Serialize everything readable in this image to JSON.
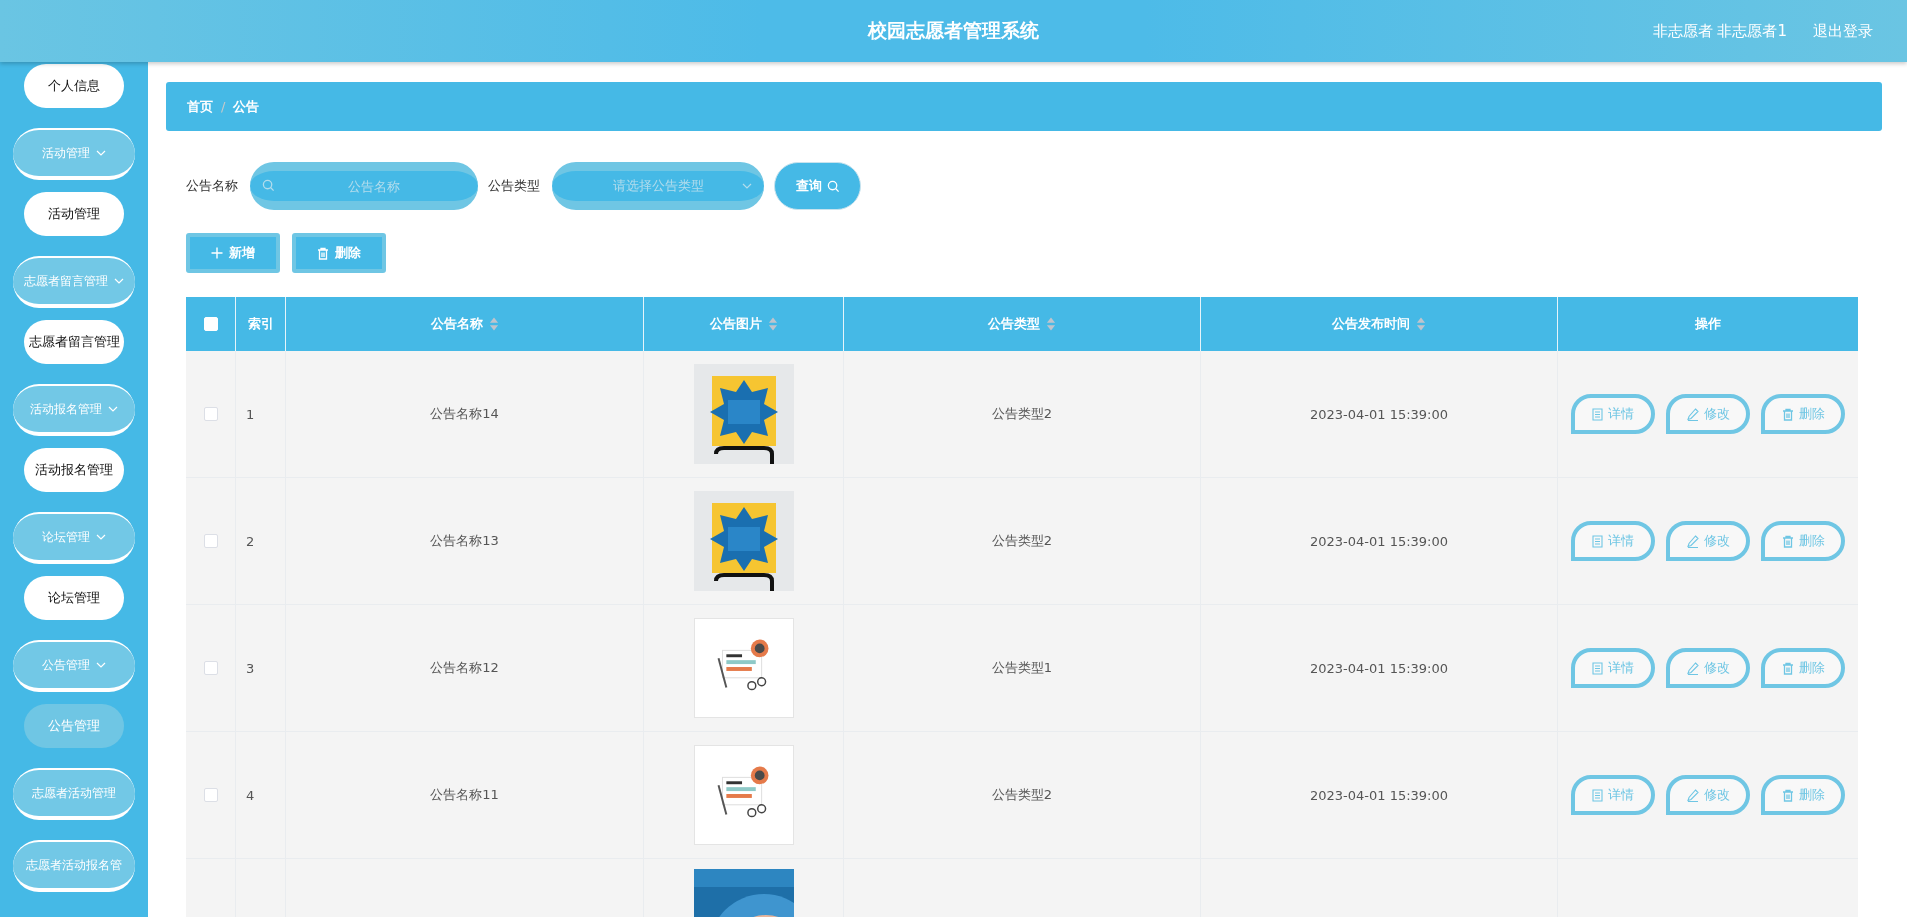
{
  "header": {
    "title": "校园志愿者管理系统",
    "user": "非志愿者 非志愿者1",
    "logout": "退出登录"
  },
  "sidebar": {
    "items": [
      {
        "kind": "link",
        "label": "个人信息",
        "selected": false
      },
      {
        "kind": "group",
        "label": "活动管理",
        "expanded": true,
        "children": [
          {
            "label": "活动管理",
            "selected": false
          }
        ]
      },
      {
        "kind": "group",
        "label": "志愿者留言管理",
        "expanded": true,
        "children": [
          {
            "label": "志愿者留言管理",
            "selected": false
          }
        ]
      },
      {
        "kind": "group",
        "label": "活动报名管理",
        "expanded": true,
        "children": [
          {
            "label": "活动报名管理",
            "selected": false
          }
        ]
      },
      {
        "kind": "group",
        "label": "论坛管理",
        "expanded": true,
        "children": [
          {
            "label": "论坛管理",
            "selected": false
          }
        ]
      },
      {
        "kind": "group",
        "label": "公告管理",
        "expanded": true,
        "children": [
          {
            "label": "公告管理",
            "selected": true
          }
        ]
      },
      {
        "kind": "group",
        "label": "志愿者活动管理",
        "expanded": false
      },
      {
        "kind": "group",
        "label": "志愿者活动报名管",
        "expanded": false
      }
    ]
  },
  "breadcrumb": {
    "separator": "/",
    "items": [
      {
        "label": "首页"
      },
      {
        "label": "公告"
      }
    ]
  },
  "search": {
    "fields": [
      {
        "kind": "input",
        "label": "公告名称",
        "placeholder": "公告名称"
      },
      {
        "kind": "select",
        "label": "公告类型",
        "placeholder": "请选择公告类型"
      }
    ],
    "button": "查询"
  },
  "toolbar": [
    {
      "kind": "add",
      "label": "新增"
    },
    {
      "kind": "delete",
      "label": "删除"
    }
  ],
  "table": {
    "select_all": {
      "checked": false
    },
    "columns": [
      {
        "label": "索引",
        "sortable": false
      },
      {
        "label": "公告名称",
        "sortable": true
      },
      {
        "label": "公告图片",
        "sortable": true
      },
      {
        "label": "公告类型",
        "sortable": true
      },
      {
        "label": "公告发布时间",
        "sortable": true
      },
      {
        "label": "操作",
        "sortable": false
      }
    ],
    "rows": [
      {
        "checked": false,
        "index": "1",
        "name": "公告名称14",
        "picture": {
          "kind": "picture"
        },
        "type": "公告类型2",
        "time": "2023-04-01 15:39:00",
        "actions": [
          {
            "kind": "detail",
            "label": "详情"
          },
          {
            "kind": "edit",
            "label": "修改"
          },
          {
            "kind": "delete",
            "label": "删除"
          }
        ]
      },
      {
        "checked": false,
        "index": "2",
        "name": "公告名称13",
        "picture": {
          "kind": "picture"
        },
        "type": "公告类型2",
        "time": "2023-04-01 15:39:00",
        "actions": [
          {
            "kind": "detail",
            "label": "详情"
          },
          {
            "kind": "edit",
            "label": "修改"
          },
          {
            "kind": "delete",
            "label": "删除"
          }
        ]
      },
      {
        "checked": false,
        "index": "3",
        "name": "公告名称12",
        "picture": {
          "kind": "picture"
        },
        "type": "公告类型1",
        "time": "2023-04-01 15:39:00",
        "actions": [
          {
            "kind": "detail",
            "label": "详情"
          },
          {
            "kind": "edit",
            "label": "修改"
          },
          {
            "kind": "delete",
            "label": "删除"
          }
        ]
      },
      {
        "checked": false,
        "index": "4",
        "name": "公告名称11",
        "picture": {
          "kind": "picture"
        },
        "type": "公告类型2",
        "time": "2023-04-01 15:39:00",
        "actions": [
          {
            "kind": "detail",
            "label": "详情"
          },
          {
            "kind": "edit",
            "label": "修改"
          },
          {
            "kind": "delete",
            "label": "删除"
          }
        ]
      },
      {
        "picture": {
          "kind": "picture"
        }
      }
    ]
  }
}
